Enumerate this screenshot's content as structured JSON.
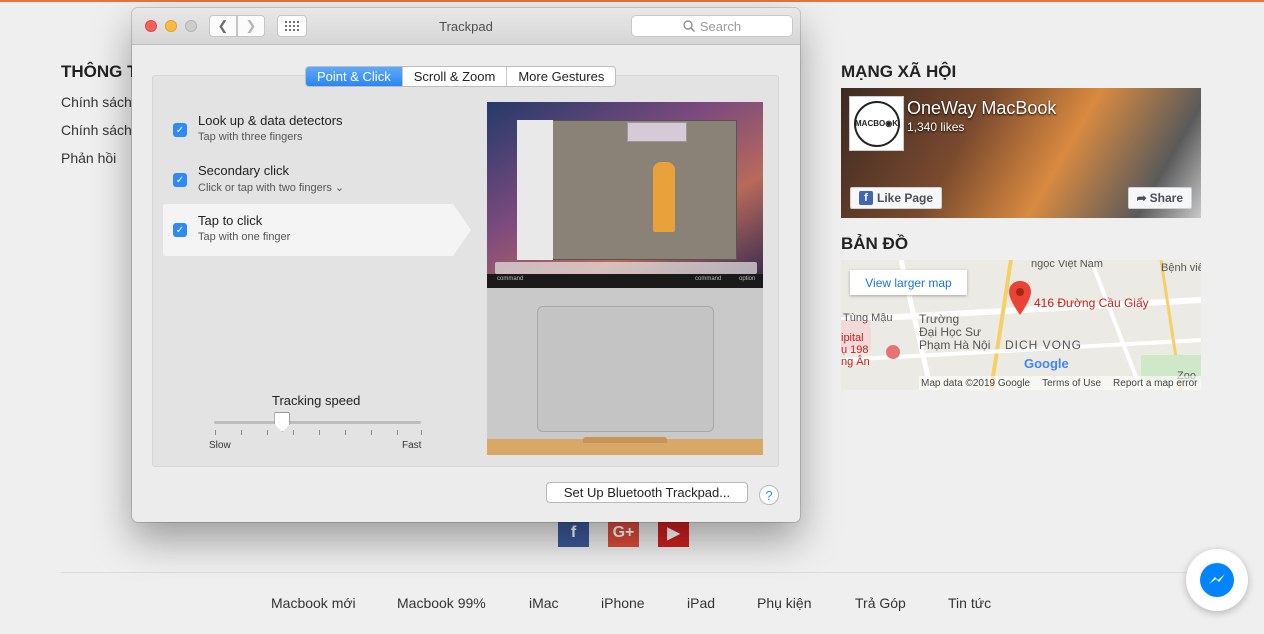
{
  "website": {
    "col_title_info": "THÔNG T",
    "links": [
      "Chính sách",
      "Chính sách",
      "Phản hồi"
    ],
    "social_title": "MẠNG XÃ HỘI",
    "map_title": "BẢN ĐỒ",
    "facebook": {
      "page_name": "OneWay MacBook",
      "likes": "1,340 likes",
      "logo_text": "MACBO◉K",
      "like_button": "Like Page",
      "share_button": "Share"
    },
    "map": {
      "view_larger": "View larger map",
      "address": "416 Đường Cầu Giấy",
      "labels": [
        "ngọc Việt Nam",
        "Bệnh viê",
        "Tùng Mậu",
        "Trường",
        "Đại Học Sư",
        "Phạm Hà Nội",
        "ipital",
        "ụ 198",
        "ng Ân",
        "Zoo"
      ],
      "district": "DICH VONG",
      "google": "Google",
      "footer": [
        "Map data ©2019 Google",
        "Terms of Use",
        "Report a map error"
      ]
    },
    "social_icons": [
      "f",
      "G+",
      "▶"
    ],
    "nav": [
      "Macbook mới",
      "Macbook 99%",
      "iMac",
      "iPhone",
      "iPad",
      "Phụ kiện",
      "Trả Góp",
      "Tin tức"
    ]
  },
  "window": {
    "title": "Trackpad",
    "search_placeholder": "Search",
    "tabs": [
      "Point & Click",
      "Scroll & Zoom",
      "More Gestures"
    ],
    "options": [
      {
        "title": "Look up & data detectors",
        "subtitle": "Tap with three fingers",
        "checked": true
      },
      {
        "title": "Secondary click",
        "subtitle": "Click or tap with two fingers ⌄",
        "checked": true
      },
      {
        "title": "Tap to click",
        "subtitle": "Tap with one finger",
        "checked": true
      }
    ],
    "tracking": {
      "label": "Tracking speed",
      "slow": "Slow",
      "fast": "Fast",
      "value_fraction": 0.33
    },
    "preview_keys": {
      "left1": "command",
      "right1": "command",
      "right2": "option"
    },
    "bluetooth_button": "Set Up Bluetooth Trackpad...",
    "help": "?"
  },
  "colors": {
    "accent": "#2f8af5",
    "close": "#fc605c",
    "minimize": "#fdbc40",
    "zoom": "#cdcdcd"
  }
}
